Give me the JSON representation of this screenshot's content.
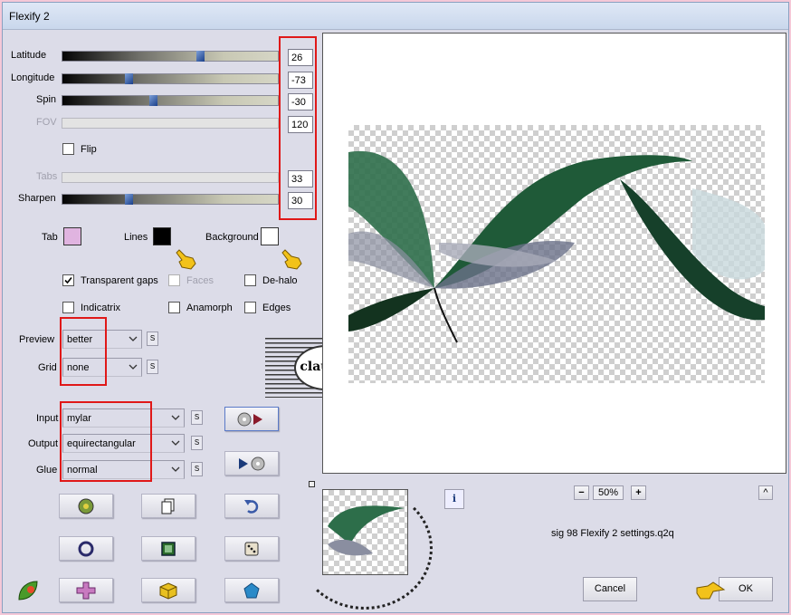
{
  "window": {
    "title": "Flexify 2"
  },
  "sliders": [
    {
      "label": "Latitude",
      "value": "26",
      "level": 0.64,
      "enabled": true
    },
    {
      "label": "Longitude",
      "value": "-73",
      "level": 0.3,
      "enabled": true
    },
    {
      "label": "Spin",
      "value": "-30",
      "level": 0.42,
      "enabled": true
    },
    {
      "label": "FOV",
      "value": "120",
      "enabled": false
    },
    {
      "label": "Tabs",
      "value": "33",
      "enabled": false
    },
    {
      "label": "Sharpen",
      "value": "30",
      "level": 0.3,
      "enabled": true
    }
  ],
  "flip": {
    "label": "Flip",
    "checked": false
  },
  "colors": {
    "tab": {
      "label": "Tab",
      "color": "#e0b4e0"
    },
    "lines": {
      "label": "Lines",
      "color": "#000000"
    },
    "background": {
      "label": "Background",
      "color": "#ffffff"
    }
  },
  "options": {
    "transparent_gaps": {
      "label": "Transparent gaps",
      "checked": true
    },
    "faces": {
      "label": "Faces",
      "checked": false,
      "enabled": false
    },
    "de_halo": {
      "label": "De-halo",
      "checked": false
    },
    "indicatrix": {
      "label": "Indicatrix",
      "checked": false
    },
    "anamorph": {
      "label": "Anamorph",
      "checked": false
    },
    "edges": {
      "label": "Edges",
      "checked": false
    }
  },
  "dropdowns": {
    "preview": {
      "label": "Preview",
      "value": "better"
    },
    "grid": {
      "label": "Grid",
      "value": "none"
    },
    "input": {
      "label": "Input",
      "value": "mylar"
    },
    "output": {
      "label": "Output",
      "value": "equirectangular"
    },
    "glue": {
      "label": "Glue",
      "value": "normal"
    }
  },
  "s_button_label": "S",
  "watermark_text": "claudia",
  "zoom": {
    "minus": "−",
    "value": "50%",
    "plus": "+"
  },
  "up_arrow": "^",
  "info_label": "i",
  "preset_filename": "sig 98 Flexify 2 settings.q2q",
  "buttons": {
    "cancel": "Cancel",
    "ok": "OK"
  },
  "icons": [
    "shuffle-dice-icon",
    "copy-icon",
    "undo-icon",
    "circle-icon",
    "square-icon",
    "dice-icon",
    "plus-cross-icon",
    "cube-icon",
    "pentagon-icon",
    "leaf-logo-icon",
    "pointing-hand-icon",
    "info-icon"
  ],
  "accent_colors": {
    "annotation_red": "#e01818",
    "window_bg": "#dcdce8",
    "page_bg": "#f5c8d8",
    "hand_yellow": "#f2c21a"
  }
}
